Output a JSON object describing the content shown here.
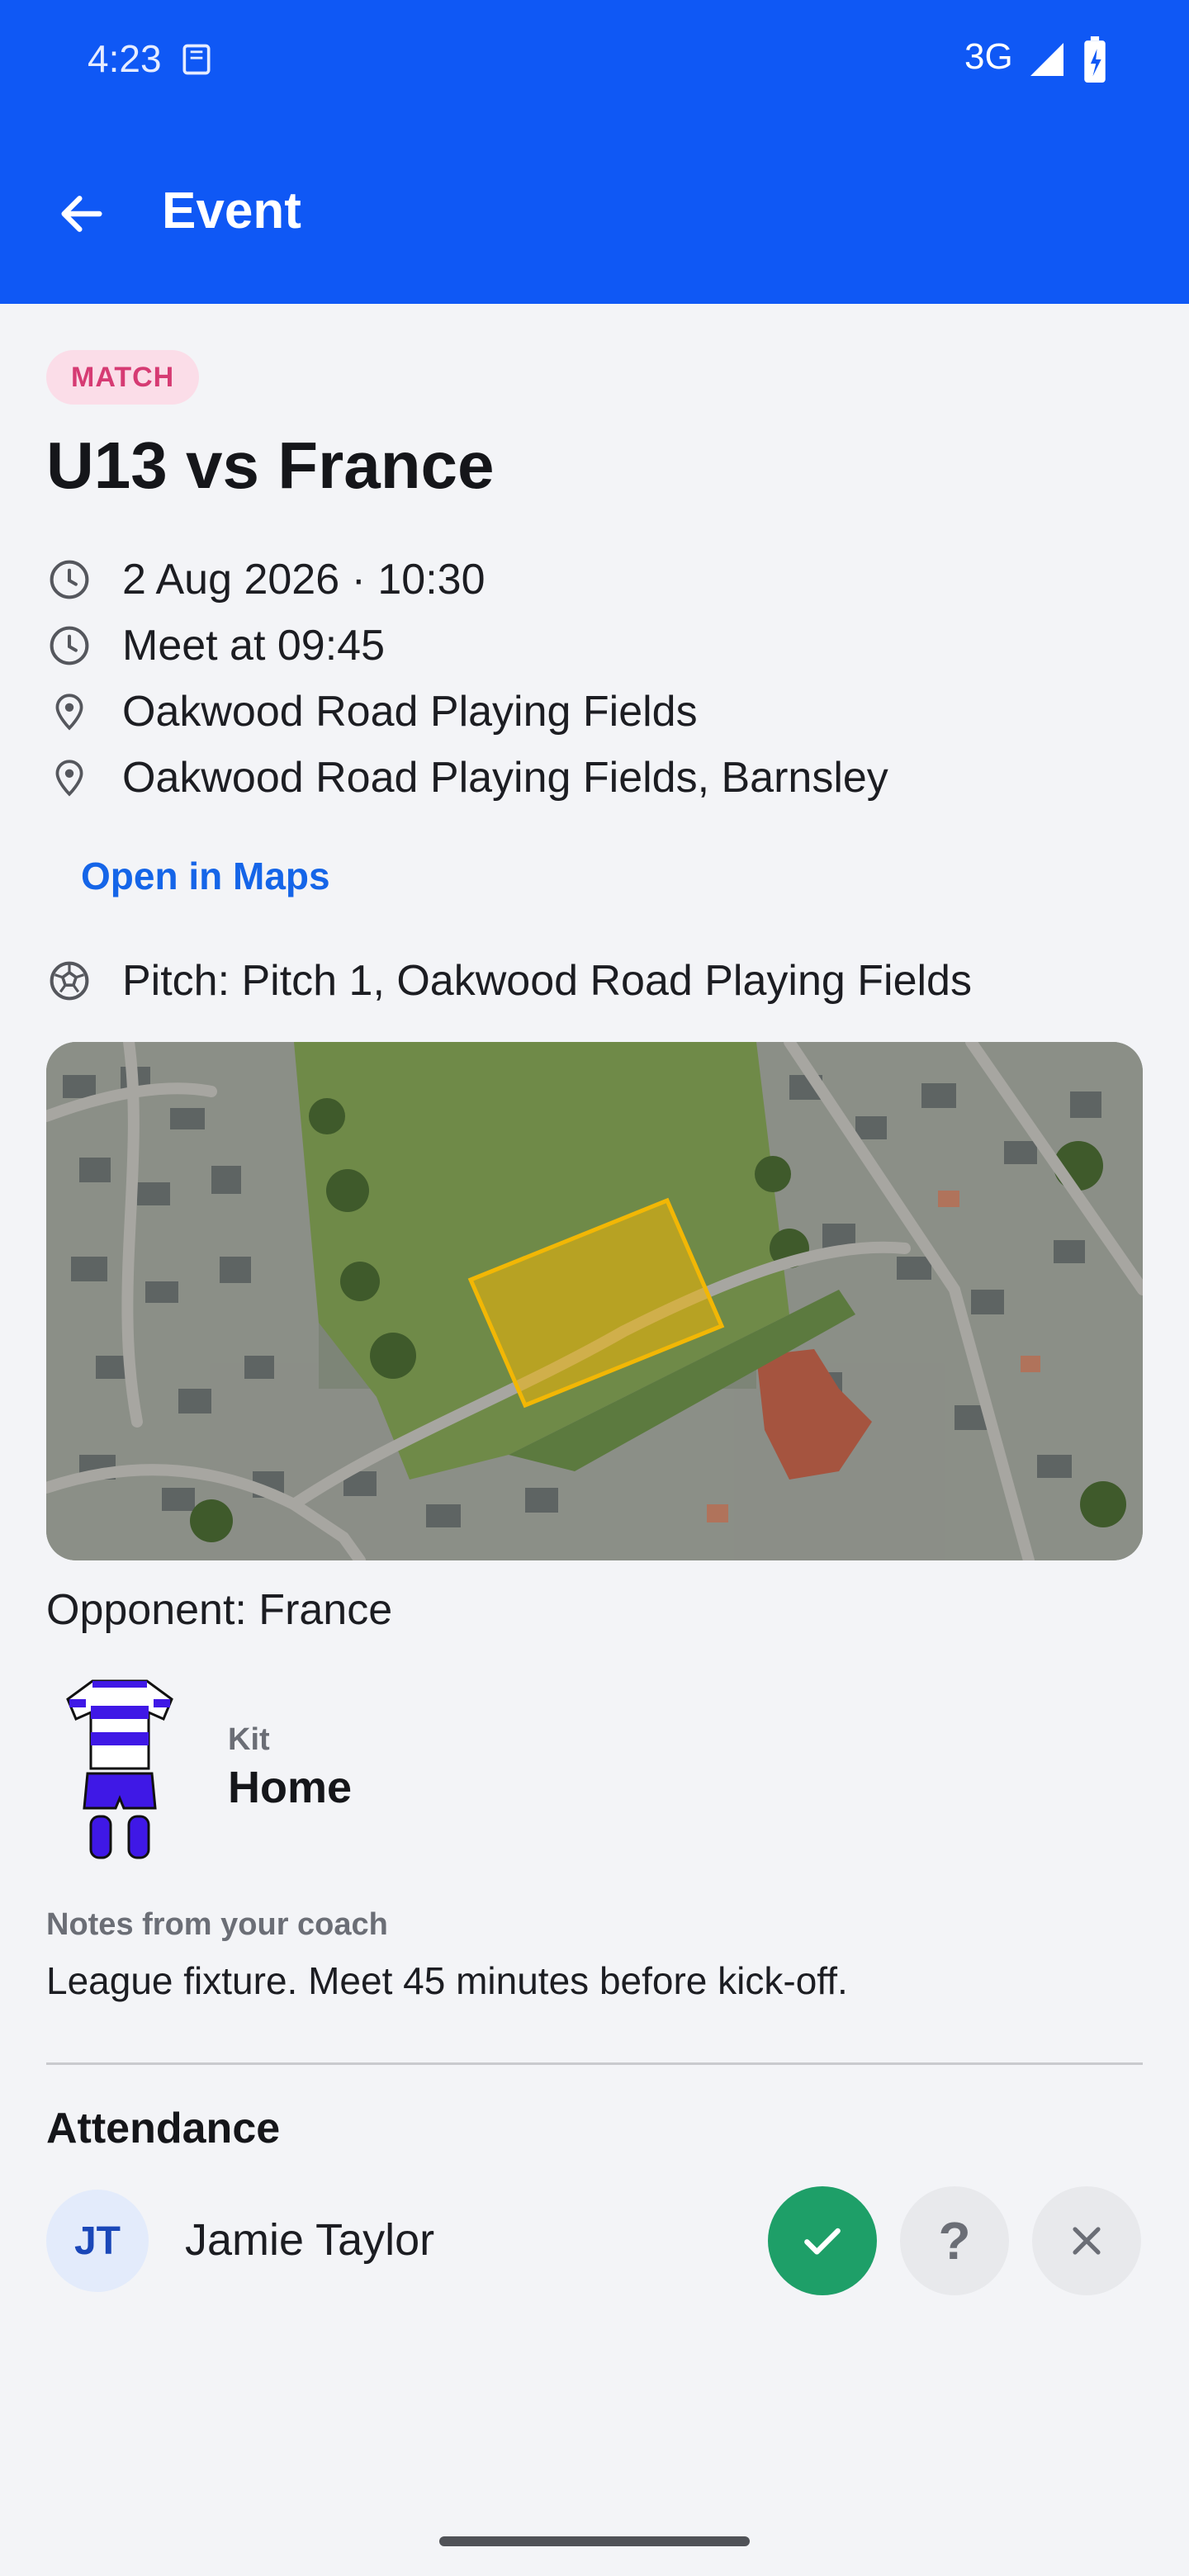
{
  "status_bar": {
    "time": "4:23",
    "network": "3G"
  },
  "app_bar": {
    "title": "Event"
  },
  "event": {
    "type_badge": "MATCH",
    "title": "U13 vs France",
    "datetime": "2 Aug 2026 · 10:30",
    "meet_time": "Meet at 09:45",
    "venue": "Oakwood Road Playing Fields",
    "address": "Oakwood Road Playing Fields, Barnsley",
    "maps_link": "Open in Maps",
    "pitch": "Pitch: Pitch 1, Oakwood Road Playing Fields",
    "opponent": "Opponent: France",
    "kit_label": "Kit",
    "kit_value": "Home",
    "notes_label": "Notes from your coach",
    "notes_text": "League fixture. Meet 45 minutes before kick-off."
  },
  "attendance": {
    "title": "Attendance",
    "members": [
      {
        "initials": "JT",
        "name": "Jamie Taylor",
        "status": "yes"
      }
    ],
    "buttons": {
      "maybe": "?"
    }
  },
  "colors": {
    "app_bar": "#0f58f5",
    "badge_bg": "#fbdde8",
    "badge_text": "#d63b73",
    "link": "#1565e8",
    "yes": "#1e9f68",
    "pitch_overlay": "#f2b705"
  }
}
